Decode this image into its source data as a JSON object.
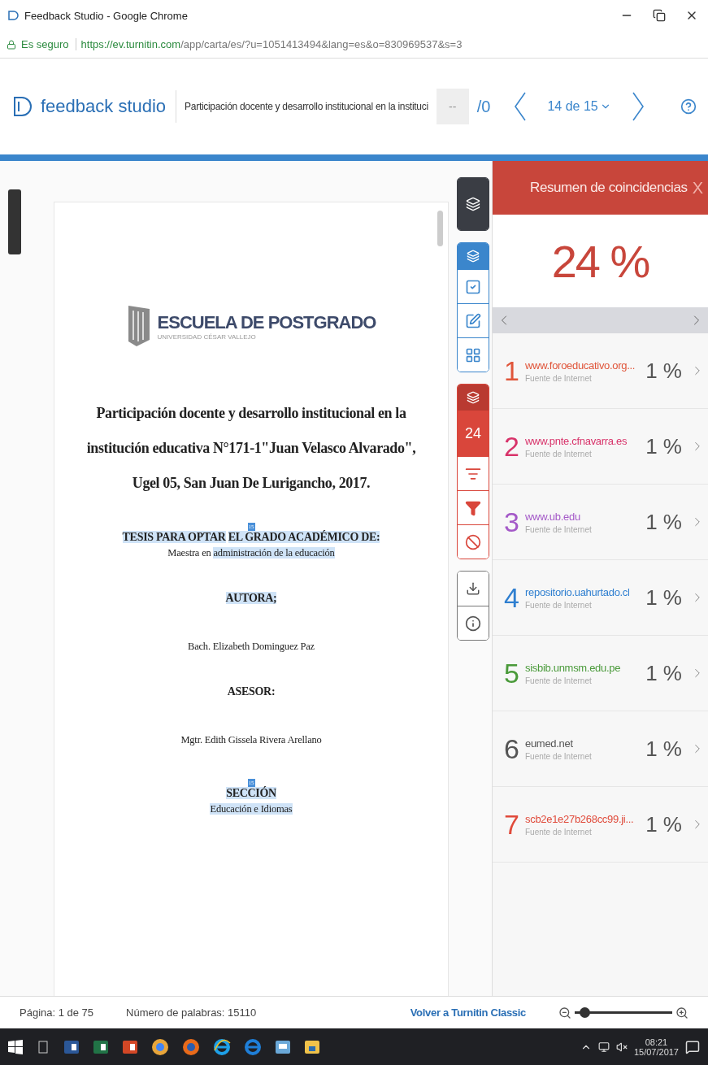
{
  "window": {
    "title": "Feedback Studio - Google Chrome"
  },
  "address_bar": {
    "secure_label": "Es seguro",
    "url_host": "https://ev.turnitin.com",
    "url_path": "/app/carta/es/?u=1051413494&lang=es&o=830969537&s=3"
  },
  "header": {
    "brand": "feedback studio",
    "doc_title": "Participación docente y desarrollo institucional en la instituci",
    "grade": "--",
    "grade_total": "/0",
    "pager": "14 de 15"
  },
  "document": {
    "logo": {
      "name": "ESCUELA DE POSTGRADO",
      "subtitle": "UNIVERSIDAD CÉSAR VALLEJO"
    },
    "title_lines": [
      "Participación docente y desarrollo institucional en la",
      "institución educativa N°171-1\"Juan Velasco Alvarado\",",
      "Ugel 05, San Juan De Lurigancho, 2017."
    ],
    "sections": [
      {
        "items": [
          {
            "kind": "marker",
            "text": "15"
          },
          {
            "kind": "heading",
            "parts": [
              {
                "text": "TESIS PARA OPTAR",
                "highlighted": true
              },
              {
                "text": "EL GRADO ACADÉMICO DE:",
                "highlighted": true
              }
            ]
          },
          {
            "kind": "line",
            "parts": [
              {
                "text": "Maestra en",
                "highlighted": false
              },
              {
                "text": "administración de la educación",
                "highlighted": true
              }
            ]
          }
        ]
      },
      {
        "items": [
          {
            "kind": "heading",
            "parts": [
              {
                "text": "AUTORA;",
                "highlighted": true
              }
            ]
          }
        ]
      },
      {
        "items": [
          {
            "kind": "line",
            "parts": [
              {
                "text": "Bach. Elizabeth Dominguez Paz",
                "highlighted": false
              }
            ]
          }
        ]
      },
      {
        "items": [
          {
            "kind": "heading",
            "parts": [
              {
                "text": "ASESOR:",
                "highlighted": false
              }
            ]
          }
        ]
      },
      {
        "items": [
          {
            "kind": "line",
            "parts": [
              {
                "text": "Mgtr.  Edith Gissela Rivera Arellano",
                "highlighted": false
              }
            ]
          }
        ]
      },
      {
        "items": [
          {
            "kind": "marker",
            "text": "15"
          },
          {
            "kind": "heading",
            "parts": [
              {
                "text": "SECCIÓN",
                "highlighted": true
              }
            ]
          },
          {
            "kind": "line",
            "parts": [
              {
                "text": "Educación e Idiomas",
                "highlighted": true
              }
            ]
          }
        ]
      }
    ]
  },
  "tools": {
    "similarity_count": "24"
  },
  "match_panel": {
    "title": "Resumen de coincidencias",
    "close": "X",
    "total": "24 %",
    "matches": [
      {
        "number": "1",
        "source": "www.foroeducativo.org...",
        "type": "Fuente de Internet",
        "percent": "1 %",
        "color": "#e0553a"
      },
      {
        "number": "2",
        "source": "www.pnte.cfnavarra.es",
        "type": "Fuente de Internet",
        "percent": "1 %",
        "color": "#d8336a"
      },
      {
        "number": "3",
        "source": "www.ub.edu",
        "type": "Fuente de Internet",
        "percent": "1 %",
        "color": "#a459c8"
      },
      {
        "number": "4",
        "source": "repositorio.uahurtado.cl",
        "type": "Fuente de Internet",
        "percent": "1 %",
        "color": "#2f7fd0"
      },
      {
        "number": "5",
        "source": "sisbib.unmsm.edu.pe",
        "type": "Fuente de Internet",
        "percent": "1 %",
        "color": "#4a9a3a"
      },
      {
        "number": "6",
        "source": "eumed.net",
        "type": "Fuente de Internet",
        "percent": "1 %",
        "color": "#555555"
      },
      {
        "number": "7",
        "source": "scb2e1e27b268cc99.ji...",
        "type": "Fuente de Internet",
        "percent": "1 %",
        "color": "#e04a3a"
      }
    ]
  },
  "status_bar": {
    "page": "Página: 1 de 75",
    "words": "Número de palabras: 15110",
    "classic_link": "Volver a Turnitin Classic",
    "zoom": {
      "level": 0.1
    }
  },
  "taskbar": {
    "time": "08:21",
    "date": "15/07/2017"
  }
}
